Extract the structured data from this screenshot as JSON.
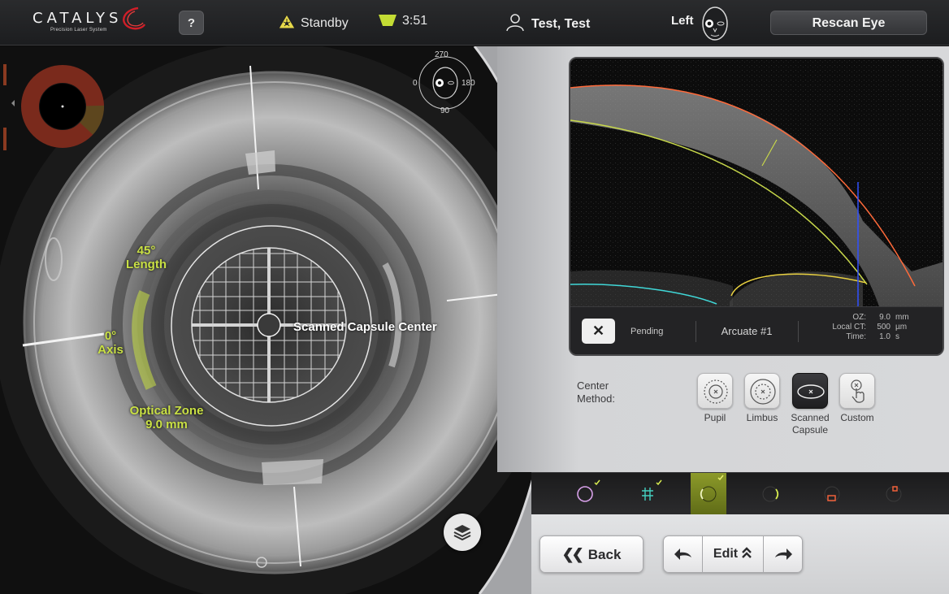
{
  "header": {
    "logo_name": "CATALYS",
    "logo_tagline": "Precision Laser System",
    "help_label": "?",
    "status_label": "Standby",
    "timer": "3:51",
    "patient_name": "Test, Test",
    "eye_side": "Left",
    "rescan_label": "Rescan Eye"
  },
  "video": {
    "orientation_labels": {
      "top": "270",
      "left": "0",
      "right": "180",
      "bottom": "90"
    },
    "incision_length": "45°",
    "incision_length_label": "Length",
    "axis_value": "0°",
    "axis_label": "Axis",
    "optical_zone_label": "Optical Zone",
    "optical_zone_value": "9.0 mm",
    "center_label": "Scanned Capsule Center",
    "layers_icon": "layers-icon"
  },
  "oct": {
    "close_label": "✕",
    "status": "Pending",
    "incision_name": "Arcuate #1",
    "params": [
      {
        "key": "OZ:",
        "value": "9.0",
        "unit": "mm"
      },
      {
        "key": "Local CT:",
        "value": "500",
        "unit": "µm"
      },
      {
        "key": "Time:",
        "value": "1.0",
        "unit": "s"
      }
    ]
  },
  "center_method": {
    "label_line1": "Center",
    "label_line2": "Method:",
    "options": [
      {
        "label": "Pupil",
        "active": false
      },
      {
        "label": "Limbus",
        "active": false
      },
      {
        "label": "Scanned Capsule",
        "active": true
      },
      {
        "label": "Custom",
        "active": false
      }
    ]
  },
  "steps": [
    {
      "name": "capsulotomy",
      "done": true,
      "active": false,
      "color": "#d7a0e8"
    },
    {
      "name": "lens-fragmentation",
      "done": true,
      "active": false,
      "color": "#44d0c0"
    },
    {
      "name": "arcuate-1",
      "done": true,
      "active": true,
      "color": "#d8ec50"
    },
    {
      "name": "arcuate-2",
      "done": false,
      "active": false,
      "color": "#d8ec50"
    },
    {
      "name": "primary-incision",
      "done": false,
      "active": false,
      "color": "#f0603a"
    },
    {
      "name": "sideport-incision",
      "done": false,
      "active": false,
      "color": "#f0603a"
    }
  ],
  "nav": {
    "back_label": "Back",
    "edit_label": "Edit"
  },
  "colors": {
    "accent_yellow": "#c9e044",
    "oct_orange": "#ff6a3a",
    "oct_yellow": "#c8d84a",
    "oct_cyan": "#40d8d8",
    "oct_blue": "#3050ff"
  }
}
